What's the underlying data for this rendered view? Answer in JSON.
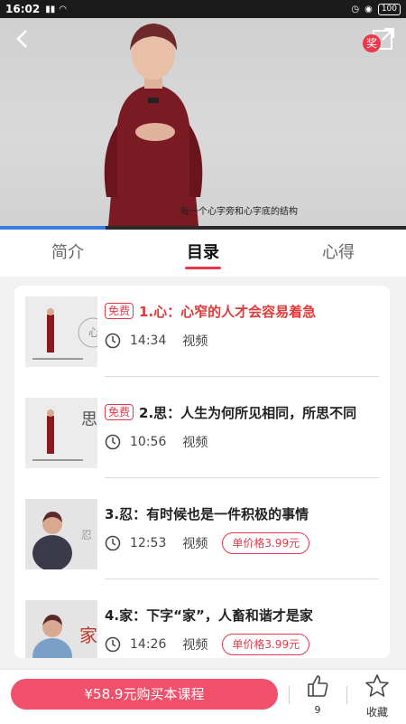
{
  "status_bar": {
    "time": "16:02",
    "battery": "100"
  },
  "video": {
    "subtitle": "每一个心字旁和心字底的结构",
    "progress": 0.26
  },
  "reward_badge": "奖",
  "tabs": [
    {
      "label": "简介"
    },
    {
      "label": "目录"
    },
    {
      "label": "心得"
    }
  ],
  "lessons": [
    {
      "free_tag": "免费",
      "title": "1.心：心窄的人才会容易着急",
      "duration": "14:34",
      "kind": "视频",
      "thumb_text": "心"
    },
    {
      "free_tag": "免费",
      "title": "2.思：人生为何所见相同，所思不同",
      "duration": "10:56",
      "kind": "视频",
      "thumb_text": "思"
    },
    {
      "title": "3.忍：有时候也是一件积极的事情",
      "duration": "12:53",
      "kind": "视频",
      "price": "单价格3.99元",
      "thumb_text": "忍"
    },
    {
      "title": "4.家：下字“家”，人畜和谐才是家",
      "duration": "14:26",
      "kind": "视频",
      "price": "单价格3.99元",
      "thumb_text": "家"
    }
  ],
  "bottom": {
    "buy_label": "¥58.9元购买本课程",
    "like_count": "9",
    "favorite_label": "收藏"
  },
  "colors": {
    "accent": "#e83a4a",
    "buy_button": "#f0506a",
    "progress": "#3a7be0"
  }
}
